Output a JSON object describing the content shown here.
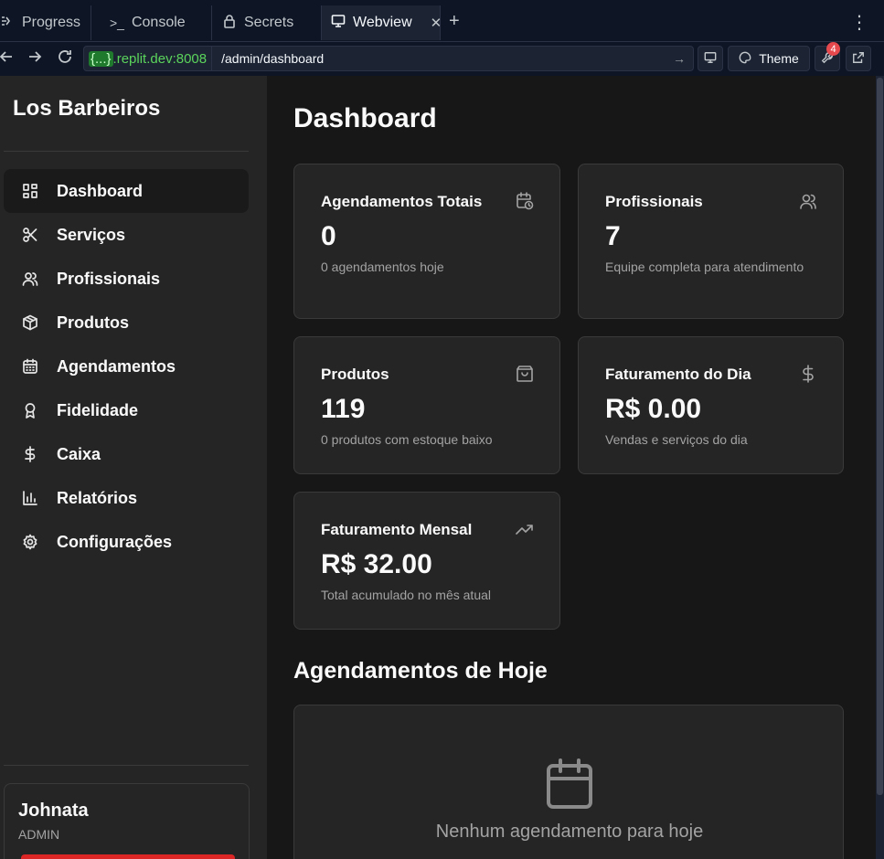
{
  "browser": {
    "tabs": [
      {
        "label": "Progress",
        "icon": "progress-icon"
      },
      {
        "label": "Console",
        "icon": "terminal-icon"
      },
      {
        "label": "Secrets",
        "icon": "lock-icon"
      },
      {
        "label": "Webview",
        "icon": "monitor-icon"
      }
    ],
    "url_host_chip": "{...}",
    "url_host": ".replit.dev:8008",
    "url_path": "/admin/dashboard",
    "theme_label": "Theme",
    "badge_count": "4"
  },
  "sidebar": {
    "brand": "Los Barbeiros",
    "items": [
      {
        "label": "Dashboard",
        "icon": "layout-grid-icon",
        "active": true
      },
      {
        "label": "Serviços",
        "icon": "scissors-icon"
      },
      {
        "label": "Profissionais",
        "icon": "users-icon"
      },
      {
        "label": "Produtos",
        "icon": "package-icon"
      },
      {
        "label": "Agendamentos",
        "icon": "calendar-icon"
      },
      {
        "label": "Fidelidade",
        "icon": "award-icon"
      },
      {
        "label": "Caixa",
        "icon": "dollar-icon"
      },
      {
        "label": "Relatórios",
        "icon": "bar-chart-icon"
      },
      {
        "label": "Configurações",
        "icon": "gear-icon"
      }
    ],
    "user": {
      "name": "Johnata",
      "role": "ADMIN"
    }
  },
  "main": {
    "title": "Dashboard",
    "cards": [
      {
        "title": "Agendamentos Totais",
        "value": "0",
        "desc": "0 agendamentos hoje",
        "icon": "calendar-clock-icon"
      },
      {
        "title": "Profissionais",
        "value": "7",
        "desc": "Equipe completa para atendimento",
        "icon": "users-icon"
      },
      {
        "title": "Produtos",
        "value": "119",
        "desc": "0 produtos com estoque baixo",
        "icon": "shopping-bag-icon"
      },
      {
        "title": "Faturamento do Dia",
        "value": "R$ 0.00",
        "desc": "Vendas e serviços do dia",
        "icon": "dollar-icon"
      },
      {
        "title": "Faturamento Mensal",
        "value": "R$ 32.00",
        "desc": "Total acumulado no mês atual",
        "icon": "trending-up-icon"
      }
    ],
    "section_title": "Agendamentos de Hoje",
    "empty_text": "Nenhum agendamento para hoje"
  }
}
